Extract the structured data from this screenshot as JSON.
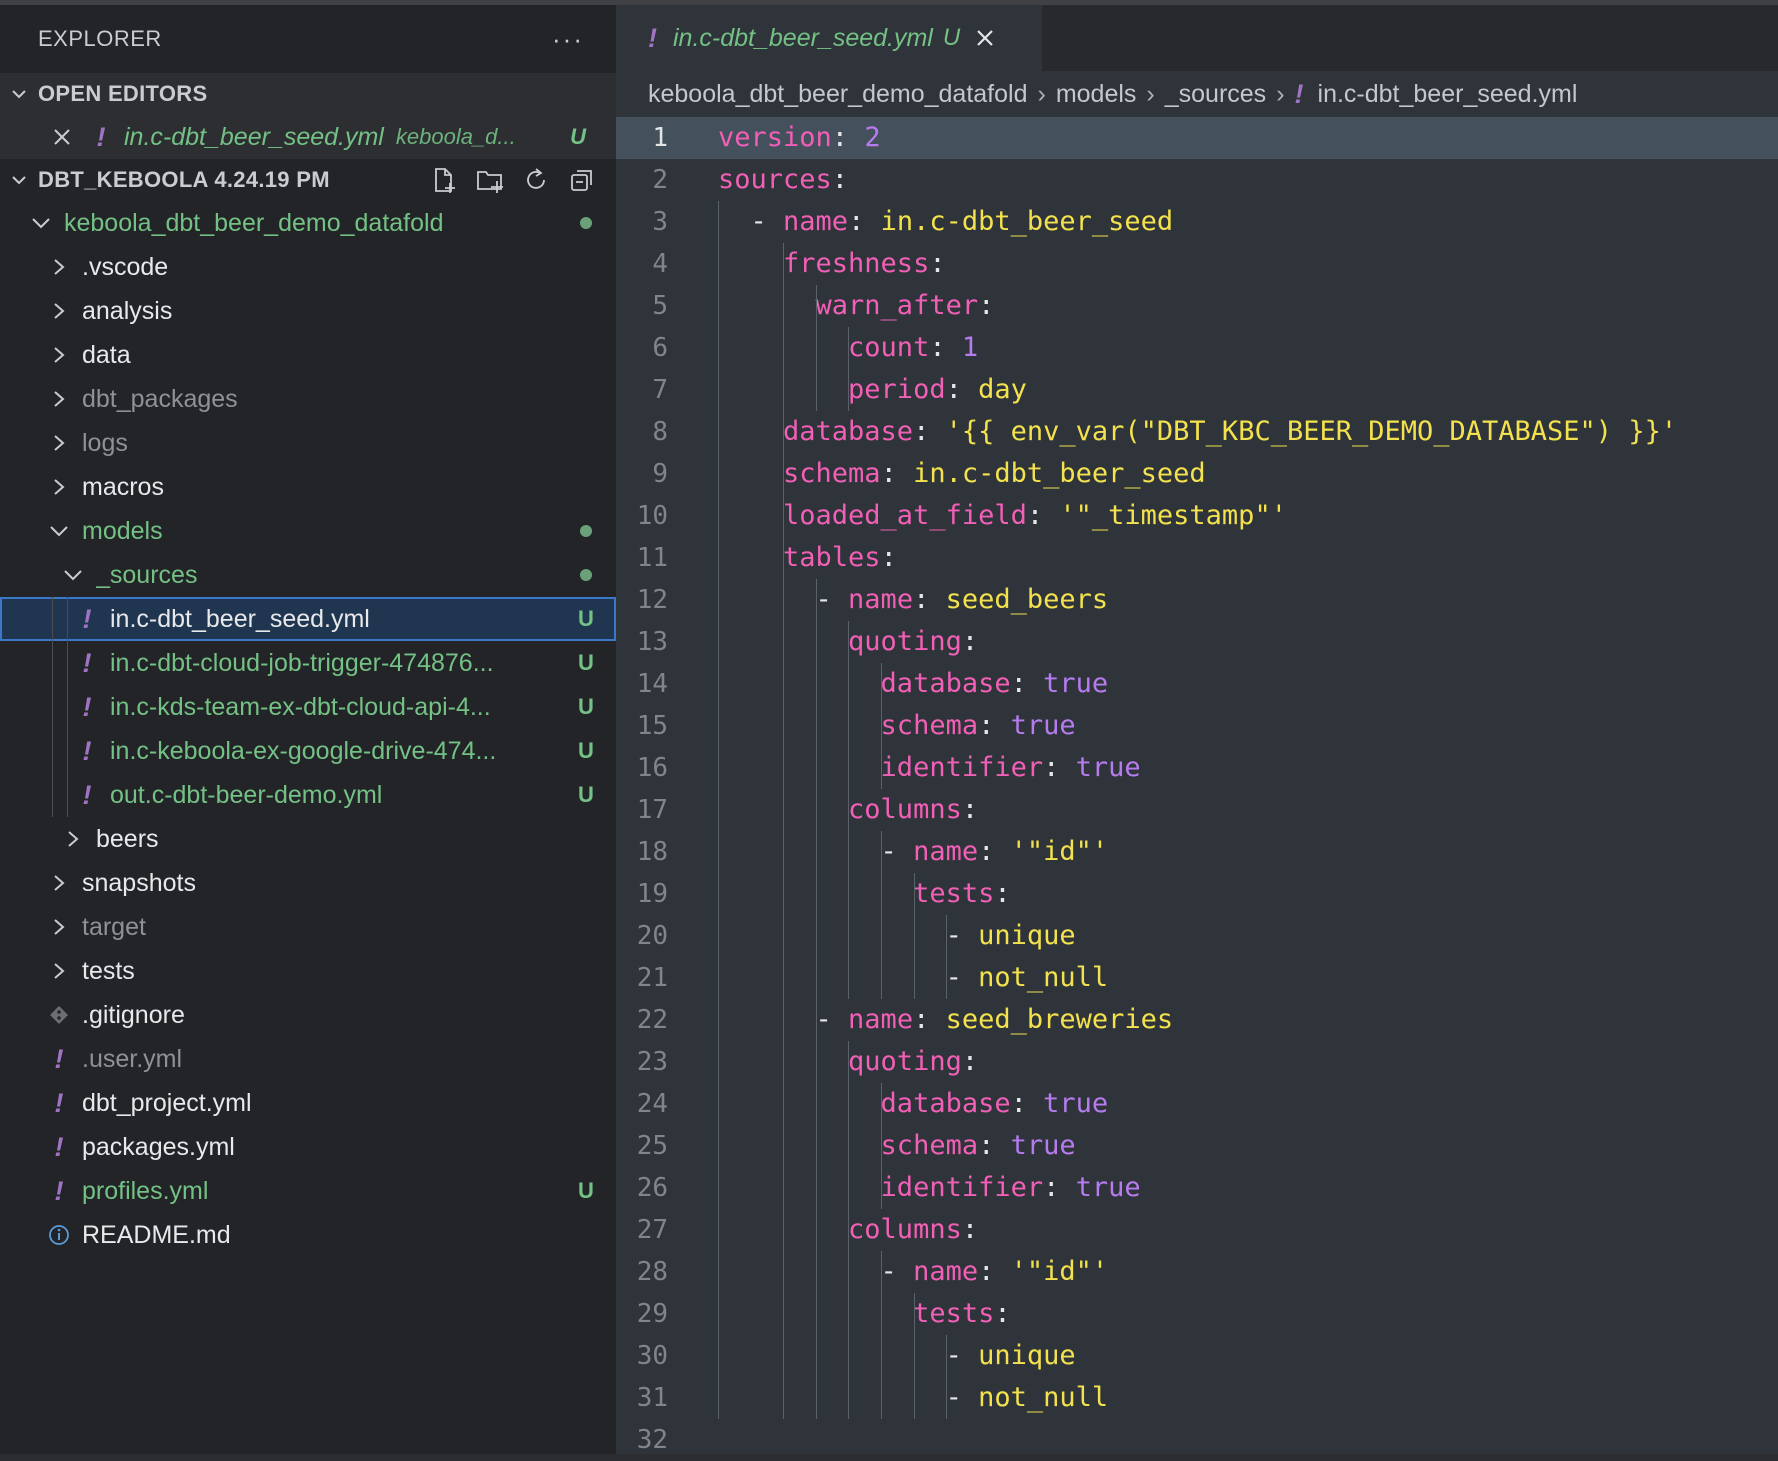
{
  "sidebar": {
    "title": "EXPLORER",
    "more": "···",
    "open_editors": {
      "title": "OPEN EDITORS",
      "items": [
        {
          "name": "in.c-dbt_beer_seed.yml",
          "path": "keboola_d...",
          "badge": "U"
        }
      ]
    },
    "workspace": {
      "title": "DBT_KEBOOLA 4.24.19 PM",
      "actions": [
        "new-file-icon",
        "new-folder-icon",
        "refresh-icon",
        "collapse-all-icon"
      ],
      "tree": [
        {
          "label": "keboola_dbt_beer_demo_datafold",
          "type": "folder-open",
          "depth": 0,
          "color": "green",
          "dot": true
        },
        {
          "label": ".vscode",
          "type": "folder",
          "depth": 1,
          "color": "white"
        },
        {
          "label": "analysis",
          "type": "folder",
          "depth": 1,
          "color": "white"
        },
        {
          "label": "data",
          "type": "folder",
          "depth": 1,
          "color": "white"
        },
        {
          "label": "dbt_packages",
          "type": "folder",
          "depth": 1,
          "color": "dim"
        },
        {
          "label": "logs",
          "type": "folder",
          "depth": 1,
          "color": "dim"
        },
        {
          "label": "macros",
          "type": "folder",
          "depth": 1,
          "color": "white"
        },
        {
          "label": "models",
          "type": "folder-open",
          "depth": 1,
          "color": "green",
          "dot": true
        },
        {
          "label": "_sources",
          "type": "folder-open",
          "depth": 2,
          "color": "green",
          "dot": true
        },
        {
          "label": "in.c-dbt_beer_seed.yml",
          "type": "yml",
          "depth": 3,
          "color": "white",
          "badge": "U",
          "selected": true
        },
        {
          "label": "in.c-dbt-cloud-job-trigger-474876...",
          "type": "yml",
          "depth": 3,
          "color": "green",
          "badge": "U"
        },
        {
          "label": "in.c-kds-team-ex-dbt-cloud-api-4...",
          "type": "yml",
          "depth": 3,
          "color": "green",
          "badge": "U"
        },
        {
          "label": "in.c-keboola-ex-google-drive-474...",
          "type": "yml",
          "depth": 3,
          "color": "green",
          "badge": "U"
        },
        {
          "label": "out.c-dbt-beer-demo.yml",
          "type": "yml",
          "depth": 3,
          "color": "green",
          "badge": "U"
        },
        {
          "label": "beers",
          "type": "folder",
          "depth": 2,
          "color": "white"
        },
        {
          "label": "snapshots",
          "type": "folder",
          "depth": 1,
          "color": "white"
        },
        {
          "label": "target",
          "type": "folder",
          "depth": 1,
          "color": "dim"
        },
        {
          "label": "tests",
          "type": "folder",
          "depth": 1,
          "color": "white"
        },
        {
          "label": ".gitignore",
          "type": "git",
          "depth": 1,
          "color": "white"
        },
        {
          "label": ".user.yml",
          "type": "yml",
          "depth": 1,
          "color": "dim"
        },
        {
          "label": "dbt_project.yml",
          "type": "yml",
          "depth": 1,
          "color": "white"
        },
        {
          "label": "packages.yml",
          "type": "yml",
          "depth": 1,
          "color": "white"
        },
        {
          "label": "profiles.yml",
          "type": "yml",
          "depth": 1,
          "color": "green",
          "badge": "U"
        },
        {
          "label": "README.md",
          "type": "info",
          "depth": 1,
          "color": "white"
        }
      ]
    }
  },
  "editor": {
    "tab": {
      "name": "in.c-dbt_beer_seed.yml",
      "badge": "U"
    },
    "breadcrumb": [
      "keboola_dbt_beer_demo_datafold",
      "models",
      "_sources",
      "in.c-dbt_beer_seed.yml"
    ],
    "lines": [
      [
        [
          "k",
          "version"
        ],
        [
          "p",
          ": "
        ],
        [
          "n",
          "2"
        ]
      ],
      [
        [
          "k",
          "sources"
        ],
        [
          "p",
          ":"
        ]
      ],
      [
        [
          "p",
          "  - "
        ],
        [
          "k",
          "name"
        ],
        [
          "p",
          ": "
        ],
        [
          "v",
          "in.c-dbt_beer_seed"
        ]
      ],
      [
        [
          "k",
          "    freshness"
        ],
        [
          "p",
          ":"
        ]
      ],
      [
        [
          "k",
          "      warn_after"
        ],
        [
          "p",
          ":"
        ]
      ],
      [
        [
          "k",
          "        count"
        ],
        [
          "p",
          ": "
        ],
        [
          "n",
          "1"
        ]
      ],
      [
        [
          "k",
          "        period"
        ],
        [
          "p",
          ": "
        ],
        [
          "v",
          "day"
        ]
      ],
      [
        [
          "k",
          "    database"
        ],
        [
          "p",
          ": "
        ],
        [
          "v",
          "'{{ env_var(\"DBT_KBC_BEER_DEMO_DATABASE\") }}'"
        ]
      ],
      [
        [
          "k",
          "    schema"
        ],
        [
          "p",
          ": "
        ],
        [
          "v",
          "in.c-dbt_beer_seed"
        ]
      ],
      [
        [
          "k",
          "    loaded_at_field"
        ],
        [
          "p",
          ": "
        ],
        [
          "v",
          "'\"_timestamp\"'"
        ]
      ],
      [
        [
          "k",
          "    tables"
        ],
        [
          "p",
          ":"
        ]
      ],
      [
        [
          "p",
          "      - "
        ],
        [
          "k",
          "name"
        ],
        [
          "p",
          ": "
        ],
        [
          "v",
          "seed_beers"
        ]
      ],
      [
        [
          "k",
          "        quoting"
        ],
        [
          "p",
          ":"
        ]
      ],
      [
        [
          "k",
          "          database"
        ],
        [
          "p",
          ": "
        ],
        [
          "n",
          "true"
        ]
      ],
      [
        [
          "k",
          "          schema"
        ],
        [
          "p",
          ": "
        ],
        [
          "n",
          "true"
        ]
      ],
      [
        [
          "k",
          "          identifier"
        ],
        [
          "p",
          ": "
        ],
        [
          "n",
          "true"
        ]
      ],
      [
        [
          "k",
          "        columns"
        ],
        [
          "p",
          ":"
        ]
      ],
      [
        [
          "p",
          "          - "
        ],
        [
          "k",
          "name"
        ],
        [
          "p",
          ": "
        ],
        [
          "v",
          "'\"id\"'"
        ]
      ],
      [
        [
          "k",
          "            tests"
        ],
        [
          "p",
          ":"
        ]
      ],
      [
        [
          "p",
          "              - "
        ],
        [
          "v",
          "unique"
        ]
      ],
      [
        [
          "p",
          "              - "
        ],
        [
          "v",
          "not_null"
        ]
      ],
      [
        [
          "p",
          "      - "
        ],
        [
          "k",
          "name"
        ],
        [
          "p",
          ": "
        ],
        [
          "v",
          "seed_breweries"
        ]
      ],
      [
        [
          "k",
          "        quoting"
        ],
        [
          "p",
          ":"
        ]
      ],
      [
        [
          "k",
          "          database"
        ],
        [
          "p",
          ": "
        ],
        [
          "n",
          "true"
        ]
      ],
      [
        [
          "k",
          "          schema"
        ],
        [
          "p",
          ": "
        ],
        [
          "n",
          "true"
        ]
      ],
      [
        [
          "k",
          "          identifier"
        ],
        [
          "p",
          ": "
        ],
        [
          "n",
          "true"
        ]
      ],
      [
        [
          "k",
          "        columns"
        ],
        [
          "p",
          ":"
        ]
      ],
      [
        [
          "p",
          "          - "
        ],
        [
          "k",
          "name"
        ],
        [
          "p",
          ": "
        ],
        [
          "v",
          "'\"id\"'"
        ]
      ],
      [
        [
          "k",
          "            tests"
        ],
        [
          "p",
          ":"
        ]
      ],
      [
        [
          "p",
          "              - "
        ],
        [
          "v",
          "unique"
        ]
      ],
      [
        [
          "p",
          "              - "
        ],
        [
          "v",
          "not_null"
        ]
      ],
      []
    ]
  }
}
